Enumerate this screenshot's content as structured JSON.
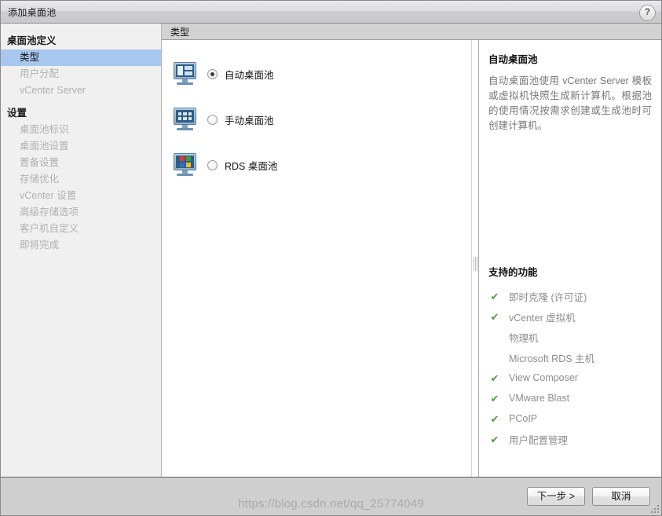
{
  "window": {
    "title": "添加桌面池",
    "help_icon": "?"
  },
  "sidebar": {
    "groups": [
      {
        "label": "桌面池定义",
        "items": [
          {
            "label": "类型",
            "active": true
          },
          {
            "label": "用户分配",
            "active": false
          },
          {
            "label": "vCenter Server",
            "active": false
          }
        ]
      },
      {
        "label": "设置",
        "items": [
          {
            "label": "桌面池标识",
            "active": false
          },
          {
            "label": "桌面池设置",
            "active": false
          },
          {
            "label": "置备设置",
            "active": false
          },
          {
            "label": "存储优化",
            "active": false
          },
          {
            "label": "vCenter 设置",
            "active": false
          },
          {
            "label": "高级存储选项",
            "active": false
          },
          {
            "label": "客户机自定义",
            "active": false
          },
          {
            "label": "即将完成",
            "active": false
          }
        ]
      }
    ]
  },
  "main": {
    "tab_header": "类型",
    "options": [
      {
        "label": "自动桌面池",
        "selected": true,
        "icon": "monitor-auto-pool-icon"
      },
      {
        "label": "手动桌面池",
        "selected": false,
        "icon": "monitor-manual-pool-icon"
      },
      {
        "label": "RDS 桌面池",
        "selected": false,
        "icon": "monitor-rds-pool-icon"
      }
    ]
  },
  "info": {
    "title": "自动桌面池",
    "description": "自动桌面池使用 vCenter Server 模板或虚拟机快照生成新计算机。根据池的使用情况按需求创建或生成池时可创建计算机。",
    "features_title": "支持的功能",
    "features": [
      {
        "label": "即时克隆 (许可证)",
        "supported": true
      },
      {
        "label": "vCenter 虚拟机",
        "supported": true
      },
      {
        "label": "物理机",
        "supported": false
      },
      {
        "label": "Microsoft RDS 主机",
        "supported": false
      },
      {
        "label": "View Composer",
        "supported": true
      },
      {
        "label": "VMware Blast",
        "supported": true
      },
      {
        "label": "PCoIP",
        "supported": true
      },
      {
        "label": "用户配置管理",
        "supported": true
      }
    ],
    "check_glyph": "✔"
  },
  "footer": {
    "next_label": "下一步 >",
    "cancel_label": "取消"
  },
  "watermark": {
    "text": "https://blog.csdn.net/qq_25774049"
  },
  "colors": {
    "accent_selection": "#a8c7ef",
    "check_green": "#4f9c3f",
    "titlebar": "#d8d8db",
    "sidebar_bg": "#f0f0f0",
    "footer_bg": "#cfcfcf"
  }
}
